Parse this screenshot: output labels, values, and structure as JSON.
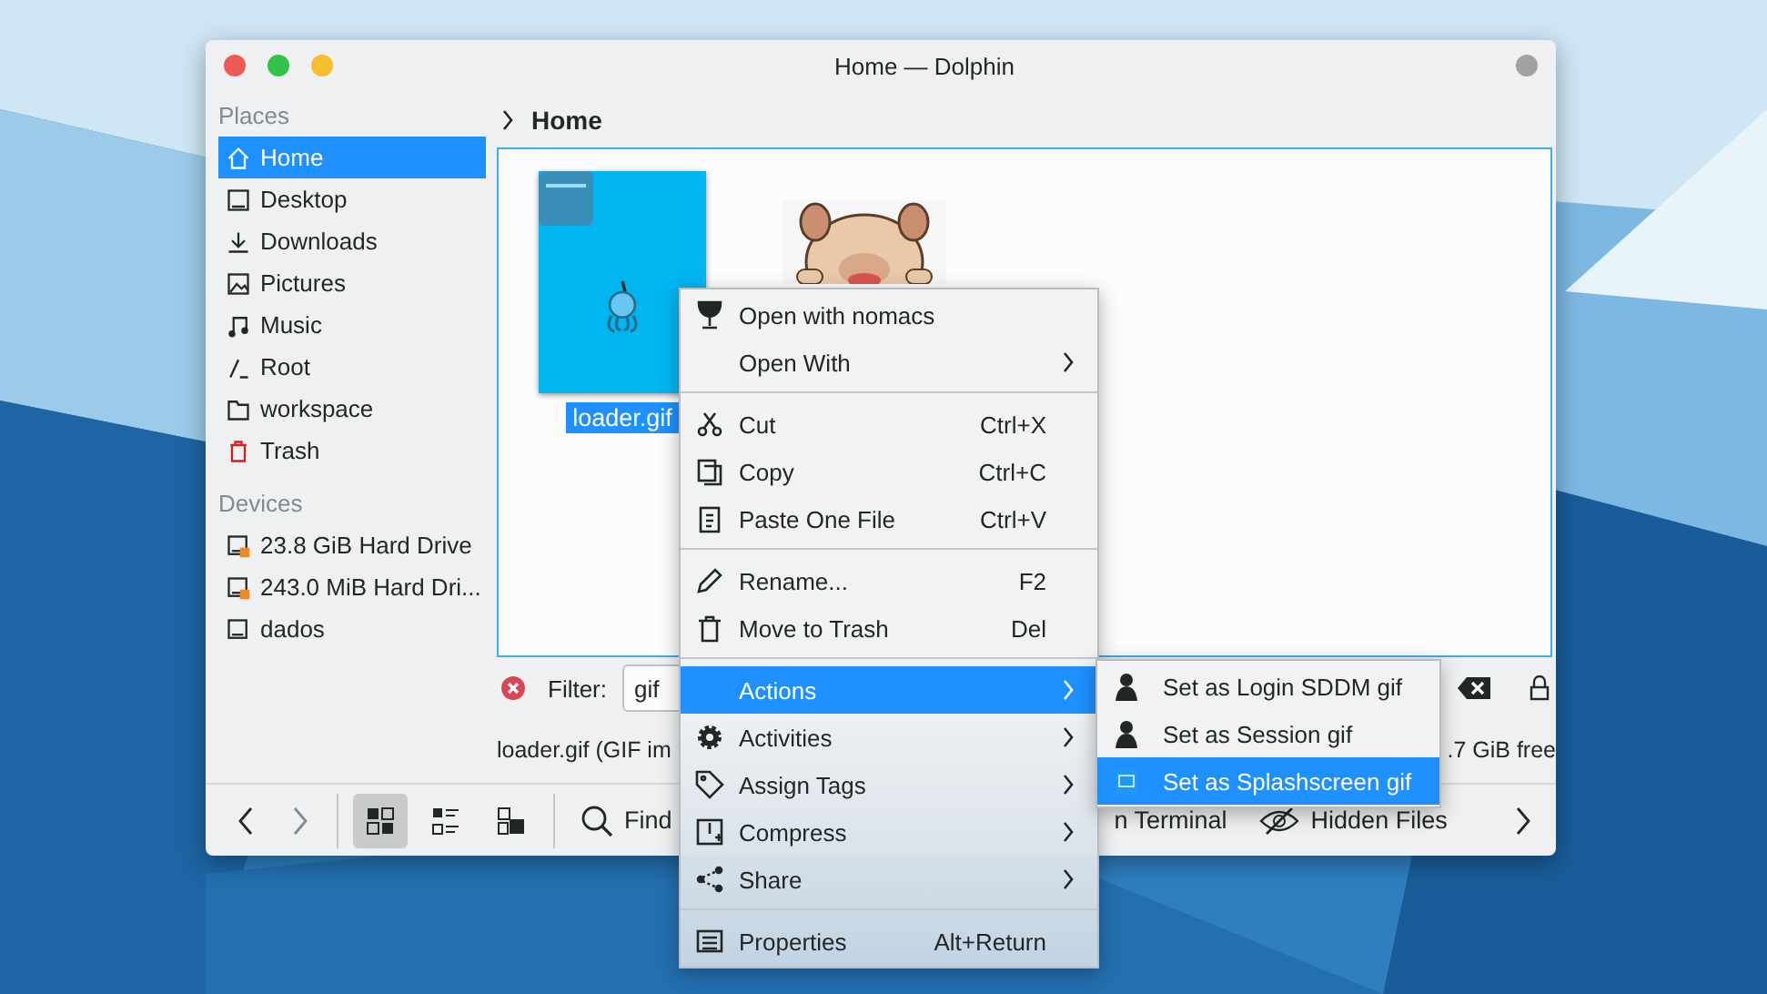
{
  "window": {
    "title": "Home — Dolphin"
  },
  "sidebar": [
    {
      "heading": "Places",
      "items": [
        {
          "label": "Home",
          "selected": true
        },
        {
          "label": "Desktop",
          "selected": false
        },
        {
          "label": "Downloads",
          "selected": false
        },
        {
          "label": "Pictures",
          "selected": false
        },
        {
          "label": "Music",
          "selected": false
        },
        {
          "label": "Root",
          "selected": false
        },
        {
          "label": "workspace",
          "selected": false
        },
        {
          "label": "Trash",
          "selected": false
        }
      ]
    },
    {
      "heading": "Devices",
      "items": [
        {
          "label": "23.8 GiB Hard Drive",
          "selected": false
        },
        {
          "label": "243.0 MiB Hard Dri...",
          "selected": false
        },
        {
          "label": "dados",
          "selected": false
        }
      ]
    }
  ],
  "breadcrumb": "Home",
  "files": [
    {
      "kind": "file",
      "name": "loader.gif",
      "selected": true
    },
    {
      "kind": "picture"
    }
  ],
  "filter": {
    "label": "Filter:",
    "value": "gif"
  },
  "status_bar": {
    "left": "loader.gif (GIF im",
    "right": ".7 GiB free"
  },
  "toolbar": {
    "view_modes": [
      {
        "selected": true
      },
      {
        "selected": false
      },
      {
        "selected": false
      }
    ],
    "find": "Find",
    "terminal": "n Terminal",
    "hidden_files": "Hidden Files"
  },
  "context_menu": [
    [
      {
        "label": "Open with nomacs",
        "submenu": false,
        "selected": false
      },
      {
        "label": "Open With",
        "submenu": true,
        "selected": false
      }
    ],
    [
      {
        "label": "Cut",
        "shortcut": "Ctrl+X",
        "submenu": false,
        "selected": false
      },
      {
        "label": "Copy",
        "shortcut": "Ctrl+C",
        "submenu": false,
        "selected": false
      },
      {
        "label": "Paste One File",
        "shortcut": "Ctrl+V",
        "submenu": false,
        "selected": false
      }
    ],
    [
      {
        "label": "Rename...",
        "shortcut": "F2",
        "submenu": false,
        "selected": false
      },
      {
        "label": "Move to Trash",
        "shortcut": "Del",
        "submenu": false,
        "selected": false
      }
    ],
    [
      {
        "label": "Actions",
        "submenu": true,
        "selected": true
      },
      {
        "label": "Activities",
        "submenu": true,
        "selected": false
      },
      {
        "label": "Assign Tags",
        "submenu": true,
        "selected": false
      },
      {
        "label": "Compress",
        "submenu": true,
        "selected": false
      },
      {
        "label": "Share",
        "submenu": true,
        "selected": false
      }
    ],
    [
      {
        "label": "Properties",
        "shortcut": "Alt+Return",
        "submenu": false,
        "selected": false
      }
    ]
  ],
  "submenu": [
    {
      "label": "Set as Login SDDM gif",
      "selected": false
    },
    {
      "label": "Set as Session gif",
      "selected": false
    },
    {
      "label": "Set as Splashscreen gif",
      "selected": true
    }
  ]
}
